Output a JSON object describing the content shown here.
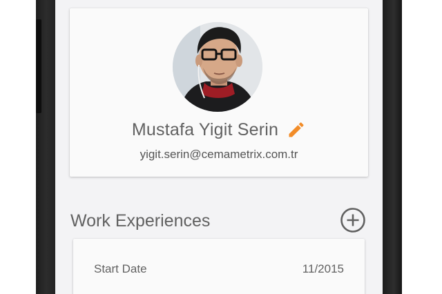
{
  "profile": {
    "name": "Mustafa Yigit Serin",
    "email": "yigit.serin@cemametrix.com.tr",
    "avatar_icon": "profile-photo",
    "edit_icon": "pencil-icon"
  },
  "work_experiences": {
    "title": "Work Experiences",
    "add_icon": "add-circle-icon",
    "items": [
      {
        "start_date_label": "Start Date",
        "start_date_value": "11/2015"
      }
    ]
  },
  "colors": {
    "accent": "#f28c28",
    "text": "#616161",
    "background": "#f3f3f5",
    "card": "#fafafa"
  }
}
